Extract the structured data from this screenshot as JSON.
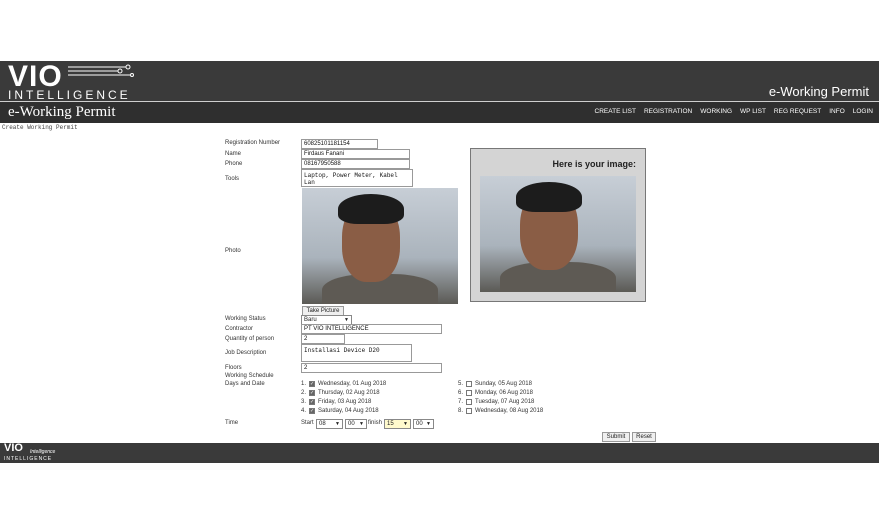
{
  "header": {
    "logo_main": "VIO",
    "logo_sub": "INTELLIGENCE",
    "app_title": "e-Working Permit",
    "app_title_left": "e-Working Permit",
    "nav": [
      "CREATE LIST",
      "REGISTRATION",
      "WORKING",
      "WP LIST",
      "REG REQUEST",
      "INFO",
      "LOGIN"
    ]
  },
  "breadcrumb": "Create Working Permit",
  "form": {
    "labels": {
      "reg": "Registration Number",
      "name": "Name",
      "phone": "Phone",
      "tools": "Tools",
      "photo": "Photo",
      "status": "Working Status",
      "contractor": "Contractor",
      "qty": "Quantity of person",
      "job": "Job Description",
      "floors": "Floors",
      "schedule": "Working Schedule",
      "days": "Days and Date",
      "time": "Time"
    },
    "values": {
      "reg": "60825101181154",
      "name": "Firdaus Fanani",
      "phone": "08167950588",
      "tools": "Laptop, Power Meter, Kabel Lan",
      "status": "Baru",
      "contractor": "PT VIO INTELLIGENCE",
      "qty": "2",
      "job": "Installasi Device D20",
      "floors": "2"
    },
    "take_picture": "Take Picture",
    "days": [
      {
        "num": "1.",
        "label": "Wednesday, 01 Aug 2018",
        "checked": true
      },
      {
        "num": "2.",
        "label": "Thursday, 02 Aug 2018",
        "checked": true
      },
      {
        "num": "3.",
        "label": "Friday, 03 Aug 2018",
        "checked": true
      },
      {
        "num": "4.",
        "label": "Saturday, 04 Aug 2018",
        "checked": true
      },
      {
        "num": "5.",
        "label": "Sunday, 05 Aug 2018",
        "checked": false
      },
      {
        "num": "6.",
        "label": "Monday, 06 Aug 2018",
        "checked": false
      },
      {
        "num": "7.",
        "label": "Tuesday, 07 Aug 2018",
        "checked": false
      },
      {
        "num": "8.",
        "label": "Wednesday, 08 Aug 2018",
        "checked": false
      }
    ],
    "time": {
      "start_label": "Start",
      "start_hour": "08",
      "start_min": "00",
      "finish_label": "finish",
      "finish_hour": "15",
      "finish_min": "00"
    },
    "submit": "Submit",
    "reset": "Reset"
  },
  "preview": {
    "title": "Here is your image:"
  },
  "footer": {
    "logo_main": "VIO",
    "logo_tag": "Intelligence",
    "logo_sub": "INTELLIGENCE"
  },
  "colors": {
    "header_bg": "#3a3a3a",
    "nav_bg": "#2f2f2f",
    "preview_bg": "#d4d4d4",
    "highlight_select": "#fffacd"
  }
}
